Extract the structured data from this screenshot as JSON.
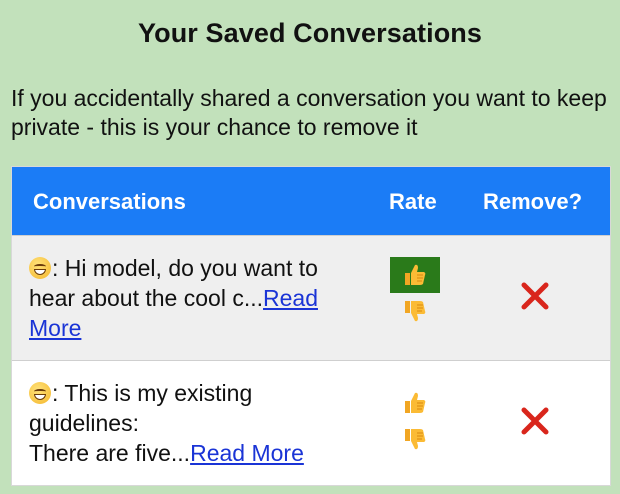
{
  "page": {
    "title": "Your Saved Conversations",
    "intro": "If you accidentally shared a conversation you want to keep private - this is your chance to remove it"
  },
  "table": {
    "headers": {
      "conversations": "Conversations",
      "rate": "Rate",
      "remove": "Remove?"
    },
    "rows": [
      {
        "emoji": "grinning-face-emoji",
        "prefix": ": ",
        "text": "Hi model, do you want to hear about the cool c...",
        "link": "Read More",
        "rating": "thumbs-up",
        "remove_icon": "red-x-icon"
      },
      {
        "emoji": "grinning-face-emoji",
        "prefix": ": ",
        "text_line1": "This is my existing guidelines:",
        "text_line2": "There are five...",
        "link": "Read More",
        "rating": "none",
        "remove_icon": "red-x-icon"
      }
    ]
  },
  "colors": {
    "background": "#c2e1bb",
    "header": "#1b7cf6",
    "active_rating": "#2a7a1a",
    "remove": "#d9261c",
    "link": "#1a34d6"
  }
}
